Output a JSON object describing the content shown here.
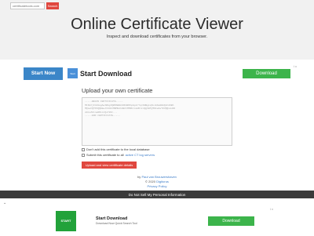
{
  "header": {
    "search_placeholder": "certificatetools.com",
    "search_button": "Search",
    "title": "Online Certificate Viewer",
    "subtitle": "Inspect and download certificates from your browser."
  },
  "ad_top": {
    "start_now": "Start Now",
    "icon_text": "Start",
    "title": "Start Download",
    "download": "Download",
    "badge": "i x"
  },
  "form": {
    "heading": "Upload your own certificate",
    "textarea_placeholder": "-----BEGIN CERTIFICATE-----\nMIIEXjCCA0agAwIBAgIQBMABBkAOFWBShpEp8/YqzANBgkqhkiG9w0BAQsFADBh\nMQswCQYDVQQGEwJVUzEVMBMGA1UEChMMRGlnaUNlcnQgSW5jMRkwFwYDVQQLExB3\nd3cuZGlnaWNlcnQuY29t...\n-----END CERTIFICATE-----",
    "checkbox_1": "Don't add this certificate to the local database",
    "checkbox_2_prefix": "Submit this certificate to all",
    "checkbox_2_link": "active CT log servers",
    "submit": "Upload and view certificate details"
  },
  "footer": {
    "by_prefix": "by",
    "author": "Paul van Brouwershaven",
    "copyright": "© 2020",
    "copyright_link": "Digitorus",
    "privacy": "Privacy Policy",
    "dark_bar": "Do Not Sell My Personal Information"
  },
  "ad_bottom": {
    "icon_text": "START",
    "title": "Start Download",
    "subtitle": "Download Now Quick Search Tool",
    "download": "Download",
    "badge": "i x"
  },
  "colors": {
    "accent_red": "#e0473e",
    "download_green": "#3cb44b",
    "link_blue": "#3a7bc8"
  }
}
